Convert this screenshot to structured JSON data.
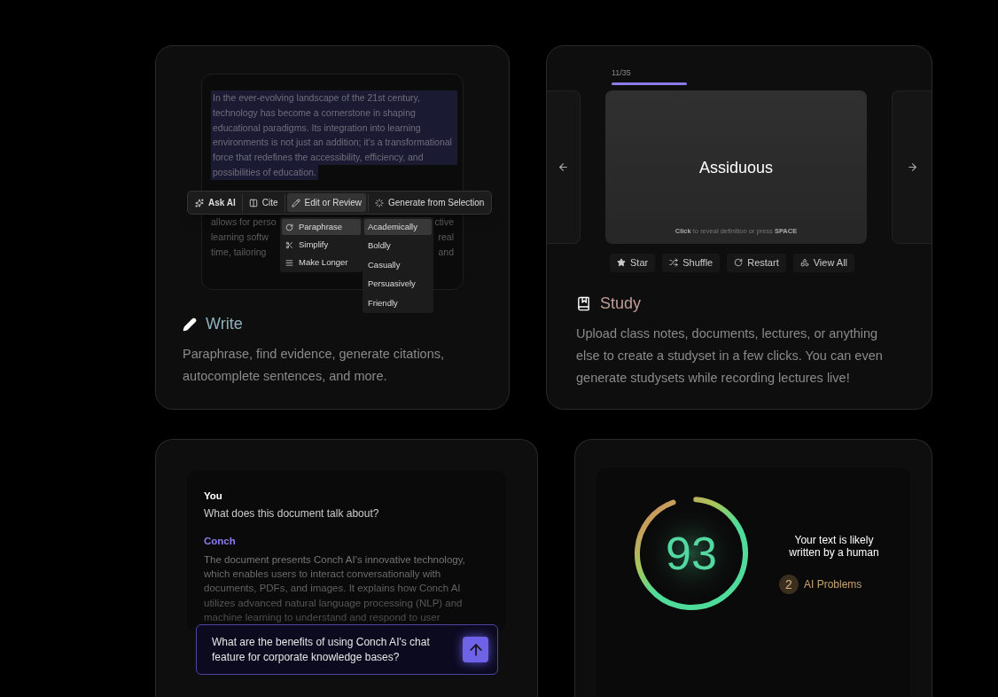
{
  "write_card": {
    "editor": {
      "highlighted_lines": [
        "In the ever-evolving landscape of the 21st century,",
        "technology has become a cornerstone in shaping",
        "educational paradigms. Its integration into learning",
        "environments is not just an addition; it's a transformational",
        "force that redefines the accessibility, efficiency, and",
        "possibilities of education."
      ],
      "hidden_lines": [
        {
          "left": "allows for perso",
          "right": "ctive"
        },
        {
          "left": "learning softw",
          "right": "real"
        },
        {
          "left": "time, tailoring",
          "right": "and"
        }
      ]
    },
    "toolbar": [
      {
        "label": "Ask AI",
        "selected": false
      },
      {
        "label": "Cite",
        "selected": false
      },
      {
        "label": "Edit or Review",
        "selected": true
      },
      {
        "label": "Generate from Selection",
        "selected": false
      }
    ],
    "edit_menu": [
      {
        "label": "Paraphrase",
        "selected": true
      },
      {
        "label": "Simplify",
        "selected": false
      },
      {
        "label": "Make Longer",
        "selected": false
      }
    ],
    "tone_menu": [
      {
        "label": "Academically",
        "selected": true
      },
      {
        "label": "Boldly",
        "selected": false
      },
      {
        "label": "Casually",
        "selected": false
      },
      {
        "label": "Persuasively",
        "selected": false
      },
      {
        "label": "Friendly",
        "selected": false
      }
    ],
    "title": "Write",
    "description": "Paraphrase, find evidence, generate citations, autocomplete sentences, and more."
  },
  "study_card": {
    "progress": {
      "label": "11/35",
      "level": 0.31
    },
    "flashcard": {
      "term": "Assiduous",
      "hint": "**Click** to reveal definition or press **SPACE**"
    },
    "actions": [
      "Star",
      "Shuffle",
      "Restart",
      "View All"
    ],
    "title": "Study",
    "description": "Upload class notes, documents, lectures, or anything else to create a studyset in a few clicks. You can even generate studysets while recording lectures live!"
  },
  "chat_card": {
    "messages": [
      {
        "sender": "You",
        "text": "What does this document talk about?",
        "kind": "user"
      },
      {
        "sender": "Conch",
        "text": "The document presents Conch AI's innovative technology, which enables users to interact conversationally with documents, PDFs, and images. It explains how Conch AI utilizes advanced natural language processing (NLP) and machine learning to understand and respond to user",
        "kind": "assistant"
      }
    ],
    "input": {
      "value": "What are the benefits of using Conch AI's chat feature for corporate knowledge bases?"
    }
  },
  "detector_card": {
    "score": {
      "value": "93",
      "level": 0.93
    },
    "verdict": "Your text is likely written by a human",
    "problems": {
      "count": "2",
      "label": "AI Problems"
    }
  }
}
